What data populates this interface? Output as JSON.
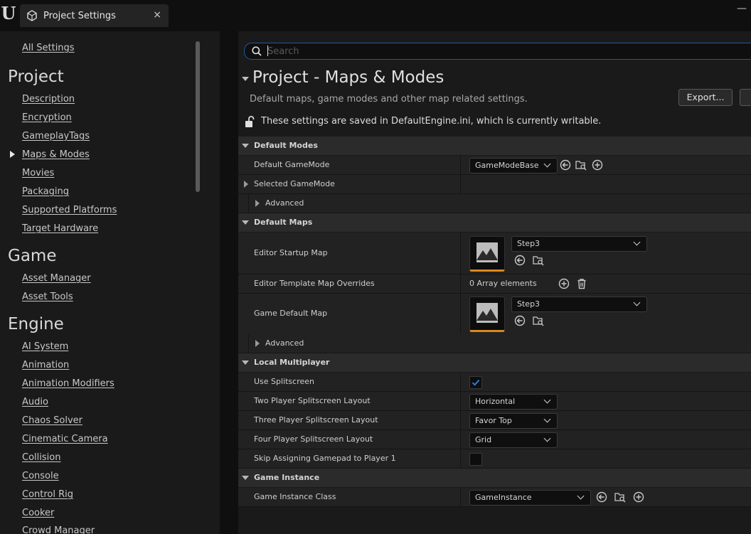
{
  "window": {
    "tab_title": "Project Settings",
    "tab_close": "×",
    "minimize": "—"
  },
  "sidebar": {
    "all_settings": "All Settings",
    "sections": [
      {
        "title": "Project",
        "items": [
          "Description",
          "Encryption",
          "GameplayTags",
          "Maps & Modes",
          "Movies",
          "Packaging",
          "Supported Platforms",
          "Target Hardware"
        ],
        "selected": "Maps & Modes"
      },
      {
        "title": "Game",
        "items": [
          "Asset Manager",
          "Asset Tools"
        ]
      },
      {
        "title": "Engine",
        "items": [
          "AI System",
          "Animation",
          "Animation Modifiers",
          "Audio",
          "Chaos Solver",
          "Cinematic Camera",
          "Collision",
          "Console",
          "Control Rig",
          "Cooker",
          "Crowd Manager"
        ]
      }
    ]
  },
  "search": {
    "placeholder": "Search",
    "value": ""
  },
  "header": {
    "title": "Project - Maps & Modes",
    "subtitle": "Default maps, game modes and other map related settings.",
    "export_label": "Export...",
    "config_note": "These settings are saved in DefaultEngine.ini, which is currently writable."
  },
  "categories": {
    "default_modes": {
      "label": "Default Modes",
      "default_gamemode_label": "Default GameMode",
      "default_gamemode_value": "GameModeBase",
      "selected_gamemode_label": "Selected GameMode",
      "advanced_label": "Advanced"
    },
    "default_maps": {
      "label": "Default Maps",
      "editor_startup_map_label": "Editor Startup Map",
      "editor_startup_map_value": "Step3",
      "editor_template_overrides_label": "Editor Template Map Overrides",
      "editor_template_overrides_value": "0 Array elements",
      "game_default_map_label": "Game Default Map",
      "game_default_map_value": "Step3",
      "advanced_label": "Advanced"
    },
    "local_multiplayer": {
      "label": "Local Multiplayer",
      "use_splitscreen_label": "Use Splitscreen",
      "use_splitscreen": true,
      "two_player_label": "Two Player Splitscreen Layout",
      "two_player_value": "Horizontal",
      "three_player_label": "Three Player Splitscreen Layout",
      "three_player_value": "Favor Top",
      "four_player_label": "Four Player Splitscreen Layout",
      "four_player_value": "Grid",
      "skip_gamepad_label": "Skip Assigning Gamepad to Player 1",
      "skip_gamepad": false
    },
    "game_instance": {
      "label": "Game Instance",
      "class_label": "Game Instance Class",
      "class_value": "GameInstance"
    }
  },
  "colors": {
    "accent_blue": "#1c5aa8",
    "checkbox_blue": "#2a7de1",
    "thumbnail_orange": "#d8891e"
  },
  "icons": {
    "logo": "unreal-logo",
    "tab": "settings-cube-icon",
    "search": "search-icon",
    "lock": "unlock-icon",
    "reset": "reset-arrow-icon",
    "browse": "browse-folder-icon",
    "add": "add-icon",
    "delete": "trash-icon",
    "map": "map-thumbnail-icon",
    "check": "check-icon"
  }
}
